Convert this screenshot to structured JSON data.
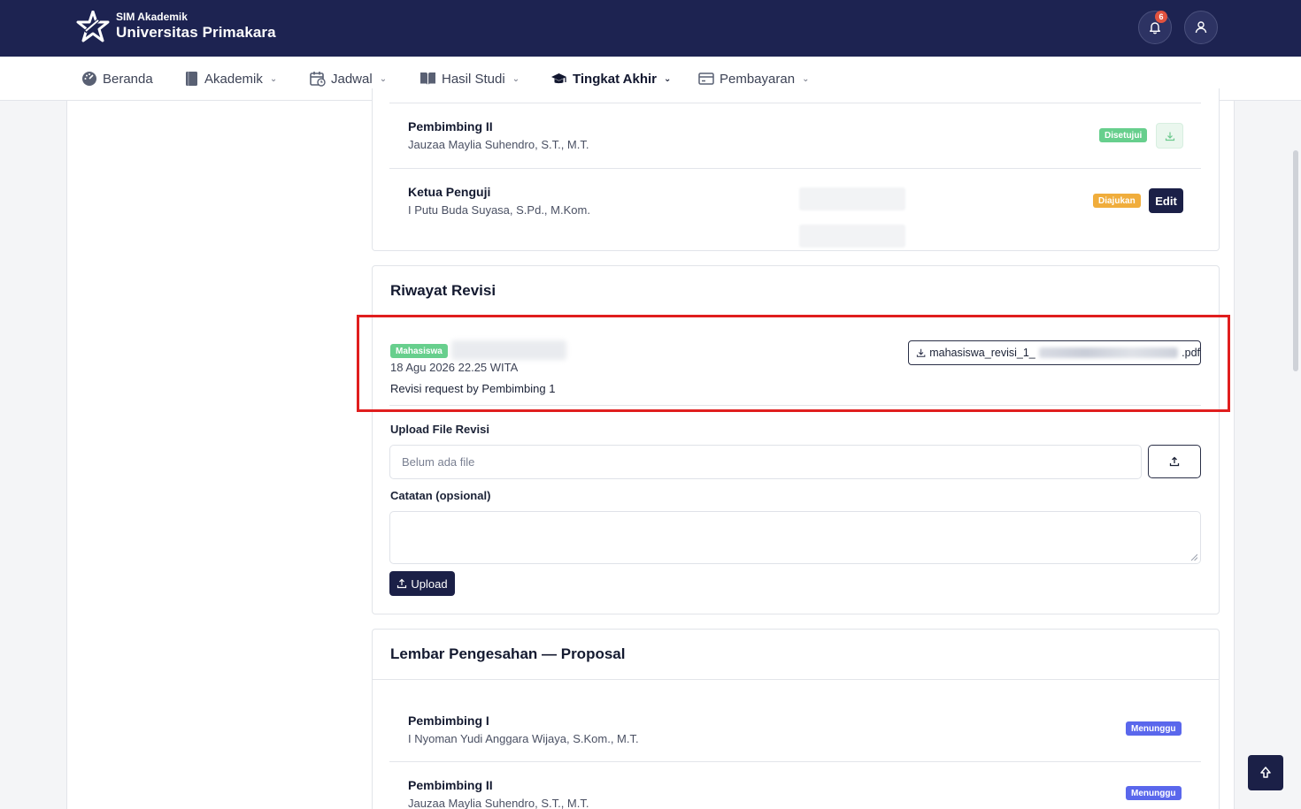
{
  "header": {
    "subtitle": "SIM Akademik",
    "title": "Universitas Primakara",
    "notification_count": "6"
  },
  "nav": {
    "items": [
      {
        "label": "Beranda"
      },
      {
        "label": "Akademik"
      },
      {
        "label": "Jadwal"
      },
      {
        "label": "Hasil Studi"
      },
      {
        "label": "Tingkat Akhir"
      },
      {
        "label": "Pembayaran"
      }
    ]
  },
  "approvals_top": [
    {
      "role": "Pembimbing II",
      "name": "Jauzaa Maylia Suhendro, S.T., M.T.",
      "status": "Disetujui"
    },
    {
      "role": "Ketua Penguji",
      "name": "I Putu Buda Suyasa, S.Pd., M.Kom.",
      "status": "Diajukan",
      "action": "Edit"
    }
  ],
  "revision_history": {
    "title": "Riwayat Revisi",
    "entry": {
      "badge": "Mahasiswa",
      "datetime": "18 Agu 2026 22.25 WITA",
      "note": "Revisi request by Pembimbing 1",
      "file_prefix": "mahasiswa_revisi_1_",
      "file_suffix": ".pdf"
    },
    "upload_label": "Upload File Revisi",
    "file_placeholder": "Belum ada file",
    "notes_label": "Catatan (opsional)",
    "upload_button": "Upload"
  },
  "approval_sheet": {
    "title": "Lembar Pengesahan — Proposal",
    "rows": [
      {
        "role": "Pembimbing I",
        "name": "I Nyoman Yudi Anggara Wijaya, S.Kom., M.T.",
        "status": "Menunggu"
      },
      {
        "role": "Pembimbing II",
        "name": "Jauzaa Maylia Suhendro, S.T., M.T.",
        "status": "Menunggu"
      }
    ]
  },
  "colors": {
    "header_bg": "#1d2351",
    "primary_button": "#1b2047",
    "approved": "#67cf8d",
    "submitted": "#f0ad3c",
    "waiting": "#5a67ec",
    "highlight": "#e01e1e"
  }
}
